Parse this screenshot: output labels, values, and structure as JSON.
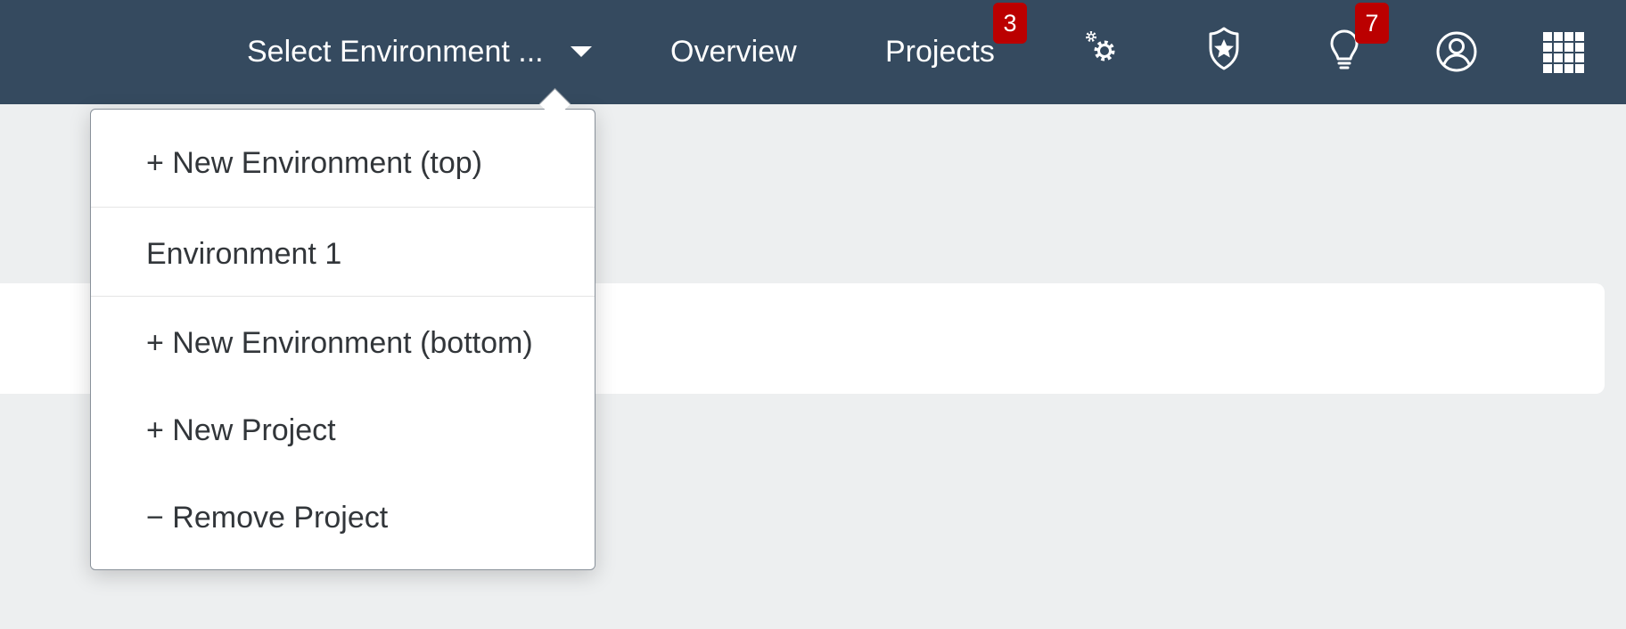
{
  "shell": {
    "environment_select": "Select Environment ...",
    "nav": {
      "overview": "Overview",
      "projects": "Projects"
    },
    "badges": {
      "projects": "3",
      "ideas": "7"
    },
    "icons": [
      "settings-icon",
      "achievement-badge-icon",
      "lightbulb-icon",
      "user-icon",
      "app-grid-icon"
    ]
  },
  "environment_menu": {
    "items": [
      "+ New Environment (top)",
      "Environment 1",
      "+ New Environment (bottom)",
      "+ New Project",
      "− Remove Project"
    ]
  },
  "colors": {
    "header_bg": "#354a5f",
    "page_bg": "#edeff0",
    "badge_bg": "#bb0000",
    "menu_text": "#32363a"
  }
}
